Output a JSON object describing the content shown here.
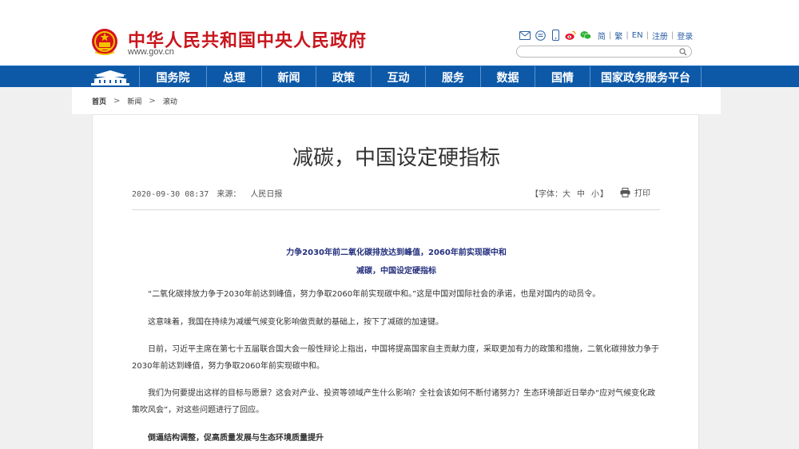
{
  "header": {
    "site_title": "中华人民共和国中央人民政府",
    "site_url": "www.gov.cn",
    "icons": [
      "mail-icon",
      "chat-icon",
      "mobile-icon",
      "weibo-icon",
      "wechat-icon"
    ],
    "links": [
      "简",
      "繁",
      "EN",
      "注册",
      "登录"
    ],
    "search_placeholder": ""
  },
  "nav": {
    "items": [
      "国务院",
      "总理",
      "新闻",
      "政策",
      "互动",
      "服务",
      "数据",
      "国情",
      "国家政务服务平台"
    ]
  },
  "breadcrumb": {
    "items": [
      "首页",
      "新闻",
      "滚动"
    ]
  },
  "article": {
    "title": "减碳，中国设定硬指标",
    "time": "2020-09-30 08:37",
    "source_label": "来源：",
    "source": "人民日报",
    "font_label": "【字体：",
    "font_options": [
      "大",
      "中",
      "小"
    ],
    "font_close": "】",
    "print_label": "打印",
    "subtitle1": "力争2030年前二氧化碳排放达到峰值，2060年前实现碳中和",
    "subtitle2": "减碳，中国设定硬指标",
    "paragraphs": [
      "“二氧化碳排放力争于2030年前达到峰值，努力争取2060年前实现碳中和。”这是中国对国际社会的承诺，也是对国内的动员令。",
      "这意味着，我国在持续为减缓气候变化影响做贡献的基础上，按下了减碳的加速键。",
      "日前，习近平主席在第七十五届联合国大会一般性辩论上指出，中国将提高国家自主贡献力度，采取更加有力的政策和措施，二氧化碳排放力争于2030年前达到峰值，努力争取2060年前实现碳中和。",
      "我们为何要提出这样的目标与愿景？这会对产业、投资等领域产生什么影响？全社会该如何不断付诸努力？生态环境部近日举办“应对气候变化政策吹风会”，对这些问题进行了回应。"
    ],
    "section_heading": "倒逼结构调整，促高质量发展与生态环境质量提升"
  },
  "colors": {
    "brand_red": "#c8161d",
    "nav_blue": "#0d59a8",
    "subtitle_blue": "#24307e"
  }
}
